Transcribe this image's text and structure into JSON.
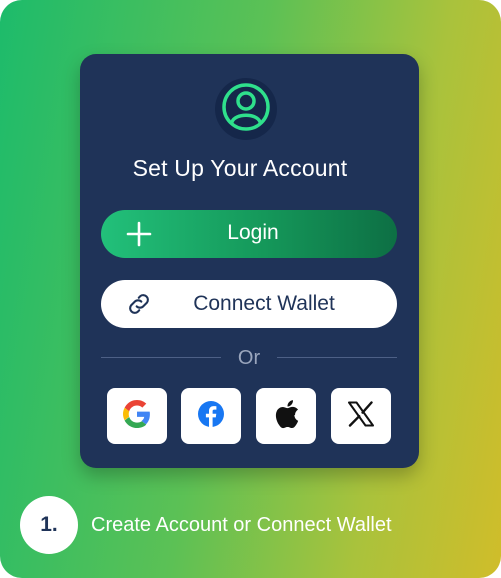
{
  "card": {
    "title": "Set Up Your Account",
    "avatar_icon": "user-circle-icon"
  },
  "login_button": {
    "label": "Login",
    "icon": "plus-icon"
  },
  "wallet_button": {
    "label": "Connect Wallet",
    "icon": "link-icon"
  },
  "divider": {
    "text": "Or"
  },
  "social": [
    {
      "name": "google",
      "icon": "google-icon"
    },
    {
      "name": "facebook",
      "icon": "facebook-icon"
    },
    {
      "name": "apple",
      "icon": "apple-icon"
    },
    {
      "name": "x",
      "icon": "x-logo-icon"
    }
  ],
  "caption": {
    "step": "1.",
    "text": "Create Account or Connect Wallet"
  },
  "colors": {
    "card_bg": "#1f3358",
    "accent_green": "#22c07a",
    "facebook_blue": "#1877f2"
  }
}
